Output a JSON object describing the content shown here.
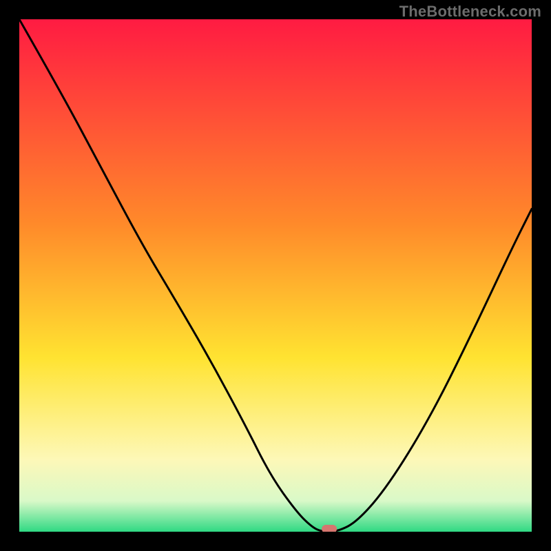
{
  "watermark": "TheBottleneck.com",
  "colors": {
    "frame": "#000000",
    "curve": "#000000",
    "marker": "#d6766f",
    "gradient": {
      "top": "#ff1b42",
      "upper_mid": "#ff8a2a",
      "mid": "#ffe331",
      "lower_pale": "#fdf8b8",
      "base_light": "#d9f9c8",
      "base": "#2fd983"
    }
  },
  "chart_data": {
    "type": "line",
    "title": "",
    "xlabel": "",
    "ylabel": "",
    "xlim": [
      0,
      100
    ],
    "ylim": [
      0,
      100
    ],
    "series": [
      {
        "name": "bottleneck-curve",
        "x": [
          0,
          8,
          16,
          24,
          30,
          37,
          44,
          49,
          54,
          57,
          59,
          62,
          66,
          72,
          80,
          88,
          96,
          100
        ],
        "y": [
          100,
          86,
          71,
          56,
          46,
          34,
          21,
          11,
          4,
          1,
          0,
          0,
          2,
          9,
          22,
          38,
          55,
          63
        ]
      }
    ],
    "marker": {
      "x": 60.5,
      "y": 0
    },
    "gradient_stops": [
      {
        "offset": 0.0,
        "key": "top"
      },
      {
        "offset": 0.4,
        "key": "upper_mid"
      },
      {
        "offset": 0.66,
        "key": "mid"
      },
      {
        "offset": 0.86,
        "key": "lower_pale"
      },
      {
        "offset": 0.94,
        "key": "base_light"
      },
      {
        "offset": 1.0,
        "key": "base"
      }
    ]
  }
}
